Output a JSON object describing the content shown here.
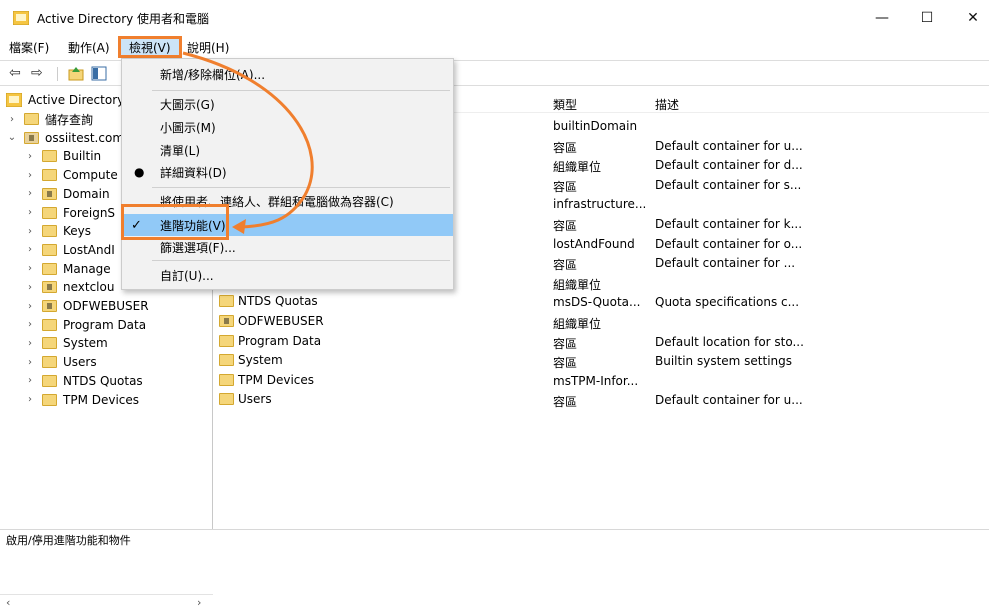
{
  "window": {
    "title": "Active Directory 使用者和電腦",
    "minimize": "—",
    "maximize": "☐",
    "close": "✕"
  },
  "menubar": {
    "items": [
      "檔案(F)",
      "動作(A)",
      "檢視(V)",
      "說明(H)"
    ]
  },
  "tree": {
    "root": "Active Directory",
    "items": [
      {
        "label": "儲存查詢",
        "indent": 1,
        "expander": "›",
        "icon": "folder"
      },
      {
        "label": "ossiitest.com",
        "indent": 1,
        "expander": "⌄",
        "icon": "domain"
      },
      {
        "label": "Builtin",
        "indent": 2,
        "expander": "›",
        "icon": "folder"
      },
      {
        "label": "Compute",
        "indent": 2,
        "expander": "›",
        "icon": "folder"
      },
      {
        "label": "Domain",
        "indent": 2,
        "expander": "›",
        "icon": "ou"
      },
      {
        "label": "ForeignS",
        "indent": 2,
        "expander": "›",
        "icon": "folder"
      },
      {
        "label": "Keys",
        "indent": 2,
        "expander": "›",
        "icon": "folder"
      },
      {
        "label": "LostAndI",
        "indent": 2,
        "expander": "›",
        "icon": "folder"
      },
      {
        "label": "Manage",
        "indent": 2,
        "expander": "›",
        "icon": "folder"
      },
      {
        "label": "nextclou",
        "indent": 2,
        "expander": "›",
        "icon": "ou"
      },
      {
        "label": "ODFWEBUSER",
        "indent": 2,
        "expander": "›",
        "icon": "ou"
      },
      {
        "label": "Program Data",
        "indent": 2,
        "expander": "›",
        "icon": "folder"
      },
      {
        "label": "System",
        "indent": 2,
        "expander": "›",
        "icon": "folder"
      },
      {
        "label": "Users",
        "indent": 2,
        "expander": "›",
        "icon": "folder"
      },
      {
        "label": "NTDS Quotas",
        "indent": 2,
        "expander": "›",
        "icon": "folder"
      },
      {
        "label": "TPM Devices",
        "indent": 2,
        "expander": "›",
        "icon": "folder"
      }
    ]
  },
  "list": {
    "headers": {
      "type": "類型",
      "desc": "描述"
    },
    "rows": [
      {
        "name": "",
        "type": "builtinDomain",
        "desc": ""
      },
      {
        "name": "",
        "type": "容區",
        "desc": "Default container for u..."
      },
      {
        "name": "",
        "type": "組織單位",
        "desc": "Default container for d..."
      },
      {
        "name": "",
        "type": "容區",
        "desc": "Default container for s..."
      },
      {
        "name": "",
        "type": "infrastructure...",
        "desc": ""
      },
      {
        "name": "",
        "type": "容區",
        "desc": "Default container for k..."
      },
      {
        "name": "",
        "type": "lostAndFound",
        "desc": "Default container for o..."
      },
      {
        "name": "",
        "type": "容區",
        "desc": "Default container for ..."
      },
      {
        "name": "",
        "type": "組織單位",
        "desc": ""
      },
      {
        "name": "NTDS Quotas",
        "type": "msDS-Quota...",
        "desc": "Quota specifications c..."
      },
      {
        "name": "ODFWEBUSER",
        "type": "組織單位",
        "desc": ""
      },
      {
        "name": "Program Data",
        "type": "容區",
        "desc": "Default location for sto..."
      },
      {
        "name": "System",
        "type": "容區",
        "desc": "Builtin system settings"
      },
      {
        "name": "TPM Devices",
        "type": "msTPM-Infor...",
        "desc": ""
      },
      {
        "name": "Users",
        "type": "容區",
        "desc": "Default container for u..."
      }
    ]
  },
  "view_menu": {
    "items": [
      "新增/移除欄位(A)...",
      "大圖示(G)",
      "小圖示(M)",
      "清單(L)",
      "詳細資料(D)",
      "將使用者、連絡人、群組和電腦做為容器(C)",
      "進階功能(V)",
      "篩選選項(F)...",
      "自訂(U)..."
    ],
    "bullet": "●",
    "check": "✓"
  },
  "status": {
    "text": "啟用/停用進階功能和物件"
  },
  "colors": {
    "highlight": "#f07f2e",
    "selected": "#91c9f7"
  }
}
